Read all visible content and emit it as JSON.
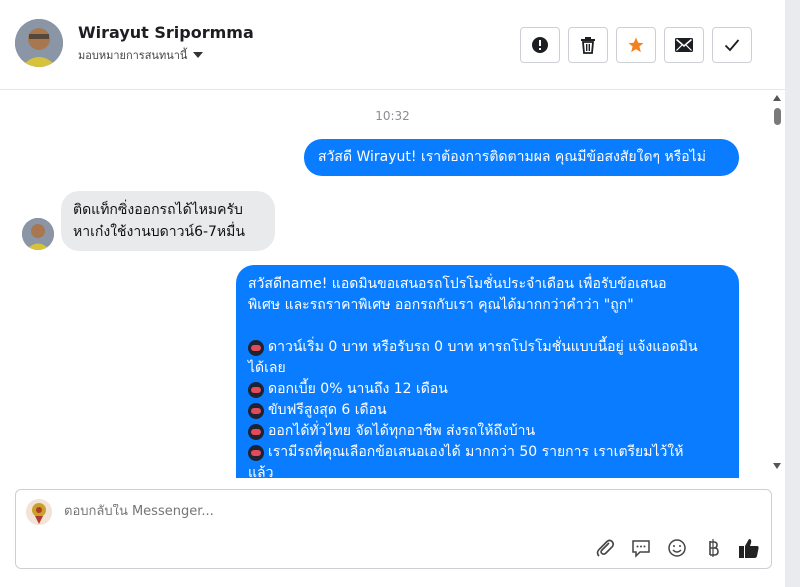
{
  "header": {
    "contact_name": "Wirayut Sripormma",
    "assign_label": "มอบหมายการสนทนานี้",
    "actions": [
      {
        "name": "report-button",
        "icon": "exclamation-circle-icon"
      },
      {
        "name": "delete-button",
        "icon": "trash-icon"
      },
      {
        "name": "star-button",
        "icon": "star-icon",
        "color": "#f4811f"
      },
      {
        "name": "mark-unread-button",
        "icon": "envelope-icon"
      },
      {
        "name": "mark-done-button",
        "icon": "checkmark-icon"
      }
    ]
  },
  "chat": {
    "timestamp": "10:32",
    "messages": [
      {
        "from": "page",
        "text": "สวัสดี Wirayut! เราต้องการติดตามผล คุณมีข้อสงสัยใดๆ หรือไม่"
      },
      {
        "from": "user",
        "lines": [
          "ติดแท็กซิ่งออกรถได้ไหมครับ",
          "หาเก๋งใช้งานบดาวน์6-7หมื่น"
        ]
      },
      {
        "from": "page",
        "intro": [
          "สวัสดีname! แอดมินขอเสนอรถโปรโมชั่นประจำเดือน เพื่อรับข้อเสนอ",
          "พิเศษ และรถราคาพิเศษ ออกรถกับเรา คุณได้มากกว่าคำว่า \"ถูก\""
        ],
        "bullets": [
          "ดาวน์เริ่ม 0 บาท หรือรับรถ 0 บาท หารถโปรโมชั่นแบบนี้อยู่ แจ้งแอดมิน",
          "ได้เลย",
          "ดอกเบี้ย 0% นานถึง 12 เดือน",
          "ขับฟรีสูงสุด 6 เดือน",
          "ออกได้ทั่วไทย จัดได้ทุกอาชีพ ส่งรถให้ถึงบ้าน",
          "เรามีรถที่คุณเลือกข้อเสนอเองได้ มากกว่า 50 รายการ เราเตรียมไว้ให้",
          "แล้ว"
        ]
      }
    ]
  },
  "composer": {
    "placeholder": "ตอบกลับใน Messenger...",
    "icons": [
      "paperclip-icon",
      "chat-bubble-icon",
      "emoji-icon",
      "baht-icon",
      "thumbs-up-icon"
    ]
  },
  "colors": {
    "accent": "#0a7cff",
    "star": "#f4811f"
  }
}
